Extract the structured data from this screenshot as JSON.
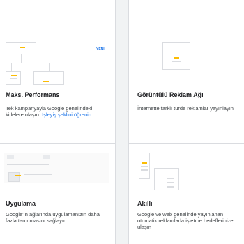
{
  "cards": [
    {
      "title": "Maks. Performans",
      "badge": "YENİ",
      "desc": "Tek kampanyayla Google genelindeki kitlelere ulaşın.",
      "link": "İşleyiş şeklini öğrenin",
      "thumb_icon": "flow-diagram-icon"
    },
    {
      "title": "Görüntülü Reklam Ağı",
      "desc": "İnternette farklı türde reklamlar yayınlayın",
      "thumb_icon": "display-ad-icon"
    },
    {
      "title": "Uygulama",
      "desc": "Google'ın ağlarında uygulamanızın daha fazla tanınmasını sağlayın",
      "thumb_icon": "app-screen-icon"
    },
    {
      "title": "Akıllı",
      "desc": "Google ve web genelinde yayınlanan otomatik reklamlarla işletme hedeflerinize ulaşın",
      "thumb_icon": "smart-ad-icon"
    }
  ]
}
